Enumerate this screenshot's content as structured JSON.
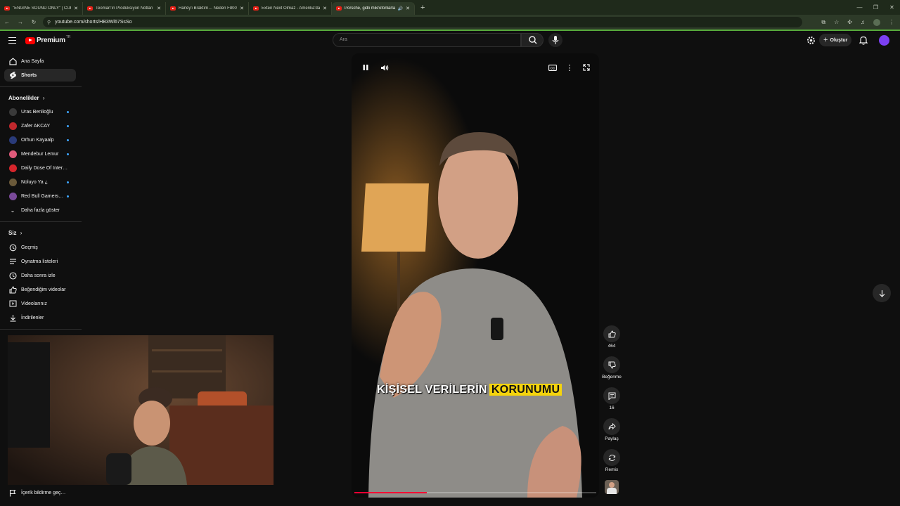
{
  "browser": {
    "tabs": [
      {
        "label": "\"ENGINE SOUND ONLY\" | CURV",
        "active": false
      },
      {
        "label": "Teoman'ın Prodüksiyon Notları",
        "active": false
      },
      {
        "label": "Harley'i Braktım… Neden F800",
        "active": false
      },
      {
        "label": "Exten Next Olmaz - Amerika'da",
        "active": false
      },
      {
        "label": "Porsche, gidli mikrofonlarla",
        "active": true
      }
    ],
    "url": "youtube.com/shorts/HB3Wl67SsSo"
  },
  "header": {
    "logo_text": "Premium",
    "logo_region": "TR",
    "search_placeholder": "Ara",
    "create_label": "Oluştur"
  },
  "sidebar": {
    "main": [
      {
        "label": "Ana Sayfa",
        "icon": "home-icon"
      },
      {
        "label": "Shorts",
        "icon": "shorts-icon",
        "active": true
      }
    ],
    "subscriptions_title": "Abonelikler",
    "subscriptions": [
      {
        "label": "Uras Benlioğlu",
        "color": "#3a3a3a"
      },
      {
        "label": "Zafer AKCAY",
        "color": "#c0282d"
      },
      {
        "label": "Orhun Kayaalp",
        "color": "#2a3b7a"
      },
      {
        "label": "Mendebur Lemur",
        "color": "#e05a7a"
      },
      {
        "label": "Daily Dose Of Inter…",
        "color": "#d6252b"
      },
      {
        "label": "Noluyo Ya ¿",
        "color": "#6b5a3a"
      },
      {
        "label": "Red Bull Gamers…",
        "color": "#7a4a9a"
      }
    ],
    "show_more": "Daha fazla göster",
    "you_title": "Siz",
    "you": [
      {
        "label": "Geçmiş",
        "icon": "history-icon"
      },
      {
        "label": "Oynatma listeleri",
        "icon": "playlists-icon"
      },
      {
        "label": "Daha sonra izle",
        "icon": "watch-later-icon"
      },
      {
        "label": "Beğendiğim videolar",
        "icon": "liked-videos-icon"
      },
      {
        "label": "Videolarınız",
        "icon": "your-videos-icon"
      },
      {
        "label": "İndirilenler",
        "icon": "downloads-icon"
      }
    ],
    "report_label": "İçerik bildirme geç…"
  },
  "player": {
    "caption_main": "KİŞİSEL VERİLERİN",
    "caption_highlight": "KORUNUMU",
    "progress": 0.3
  },
  "actions": {
    "likes": "464",
    "dislike_label": "Beğenme",
    "comments": "16",
    "share_label": "Paylaş",
    "remix_label": "Remix"
  },
  "colors": {
    "accent_red": "#ff0000",
    "caption_highlight": "#f5d40d",
    "chrome_bar": "#2d3a28"
  }
}
